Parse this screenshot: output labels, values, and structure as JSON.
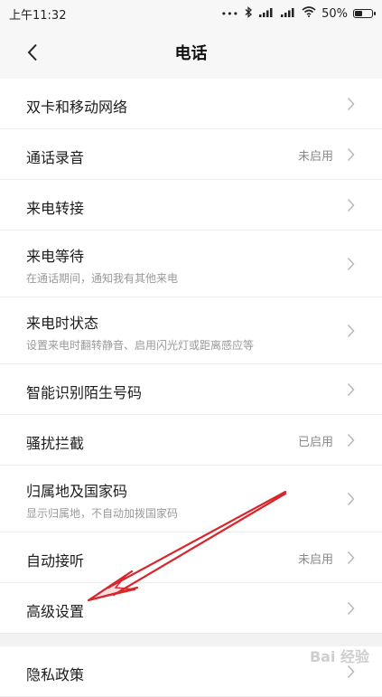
{
  "status_bar": {
    "time": "上午11:32",
    "battery": "50%",
    "battery_level": 0.5
  },
  "header": {
    "title": "电话",
    "back_icon": "chevron-left-icon"
  },
  "settings": [
    {
      "label": "双卡和移动网络",
      "sub": "",
      "value": ""
    },
    {
      "label": "通话录音",
      "sub": "",
      "value": "未启用"
    },
    {
      "label": "来电转接",
      "sub": "",
      "value": ""
    },
    {
      "label": "来电等待",
      "sub": "在通话期间，通知我有其他来电",
      "value": ""
    },
    {
      "label": "来电时状态",
      "sub": "设置来电时翻转静音、启用闪光灯或距离感应等",
      "value": ""
    },
    {
      "label": "智能识别陌生号码",
      "sub": "",
      "value": ""
    },
    {
      "label": "骚扰拦截",
      "sub": "",
      "value": "已启用"
    },
    {
      "label": "归属地及国家码",
      "sub": "显示归属地，不自动加拨国家码",
      "value": ""
    },
    {
      "label": "自动接听",
      "sub": "",
      "value": "未启用"
    },
    {
      "label": "高级设置",
      "sub": "",
      "value": ""
    }
  ],
  "settings_secondary": [
    {
      "label": "隐私政策",
      "sub": "",
      "value": ""
    }
  ],
  "watermark": "Bai 经验",
  "colors": {
    "arrow": "#d9262c",
    "background": "#f7f7f7",
    "row": "#ffffff"
  }
}
